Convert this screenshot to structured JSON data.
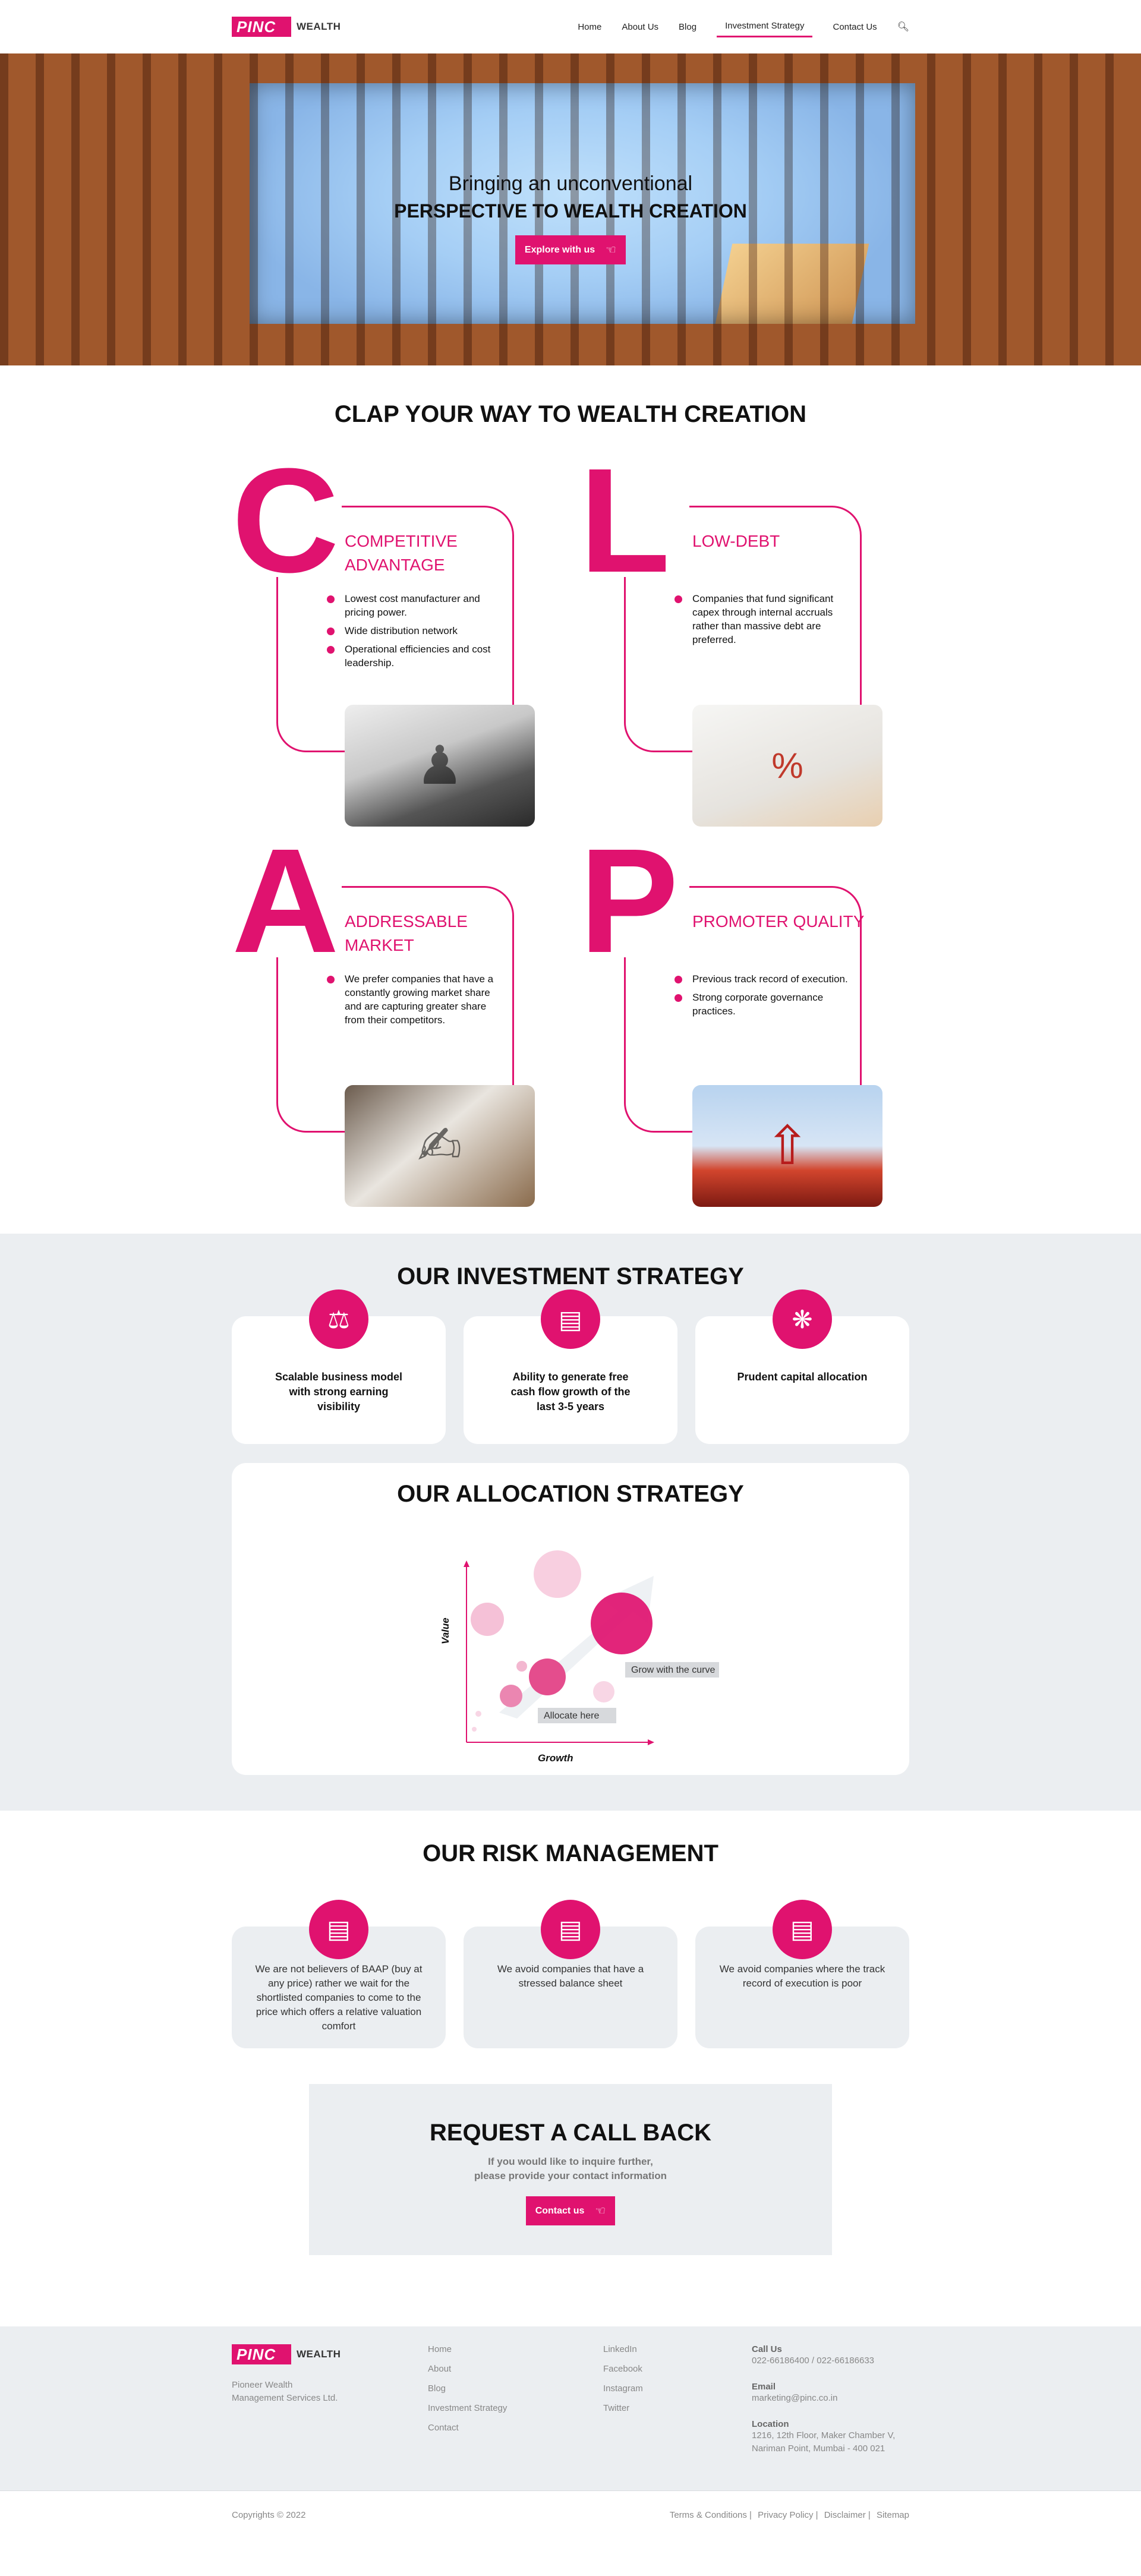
{
  "header": {
    "logo_mark": "PINC",
    "logo_word": "WEALTH",
    "nav": [
      "Home",
      "About Us",
      "Blog",
      "Investment Strategy",
      "Contact Us"
    ],
    "search_icon": "search-icon"
  },
  "hero": {
    "line1": "Bringing an unconventional",
    "line2": "PERSPECTIVE TO WEALTH CREATION",
    "button": "Explore with us",
    "button_icon": "hand-pointer-icon"
  },
  "clap": {
    "title": "CLAP YOUR WAY TO WEALTH CREATION",
    "cards": [
      {
        "letter": "C",
        "title": "COMPETITIVE ADVANTAGE",
        "points": [
          "Lowest cost manufacturer and pricing power.",
          "Wide distribution network",
          "Operational efficiencies and cost leadership."
        ]
      },
      {
        "letter": "L",
        "title": "LOW-DEBT",
        "points": [
          "Companies that fund significant capex through internal accruals rather than massive debt are preferred."
        ]
      },
      {
        "letter": "A",
        "title": "ADDRESSABLE MARKET",
        "points": [
          "We prefer companies that have a constantly growing market share and are capturing greater share from their competitors."
        ]
      },
      {
        "letter": "P",
        "title": "PROMOTER QUALITY",
        "points": [
          "Previous track record of execution.",
          "Strong corporate governance practices."
        ]
      }
    ]
  },
  "strategy": {
    "title": "OUR INVESTMENT STRATEGY",
    "cards": [
      {
        "icon": "scale-icon",
        "text": "Scalable business model with strong earning visibility"
      },
      {
        "icon": "bar-chart-icon",
        "text": "Ability to generate free cash flow growth of the last 3-5 years"
      },
      {
        "icon": "capital-hand-icon",
        "text": "Prudent capital allocation"
      }
    ]
  },
  "allocation": {
    "title": "OUR ALLOCATION STRATEGY",
    "ylabel": "Value",
    "xlabel": "Growth",
    "tag1": "Grow with the curve",
    "tag2": "Allocate here"
  },
  "risk": {
    "title": "OUR RISK MANAGEMENT",
    "cards": [
      {
        "icon": "growth-chart-icon",
        "text": "We are not believers of BAAP (buy at any price) rather we wait for the shortlisted companies to come to the price which offers a relative valuation comfort"
      },
      {
        "icon": "balance-sheet-icon",
        "text": "We avoid companies that have a stressed balance sheet"
      },
      {
        "icon": "execution-report-icon",
        "text": "We avoid companies where the track record of execution is poor"
      }
    ]
  },
  "callback": {
    "title": "REQUEST A CALL BACK",
    "line1": "If you would like to inquire further,",
    "line2": "please provide your contact information",
    "button": "Contact us"
  },
  "footer": {
    "logo_mark": "PINC",
    "logo_word": "WEALTH",
    "desc": "Pioneer Wealth Management Services Ltd.",
    "links": [
      "Home",
      "About",
      "Blog",
      "Investment Strategy",
      "Contact"
    ],
    "social": [
      "LinkedIn",
      "Facebook",
      "Instagram",
      "Twitter"
    ],
    "call_label": "Call Us",
    "call_val": "022-66186400 / 022-66186633",
    "email_label": "Email",
    "email_val": "marketing@pinc.co.in",
    "location_label": "Location",
    "location_val": "1216, 12th Floor, Maker Chamber V, Nariman Point, Mumbai - 400 021"
  },
  "bottom": {
    "copyright": "Copyrights © 2022",
    "links": [
      "Terms & Conditions",
      "Privacy Policy",
      "Disclaimer",
      "Sitemap"
    ]
  }
}
